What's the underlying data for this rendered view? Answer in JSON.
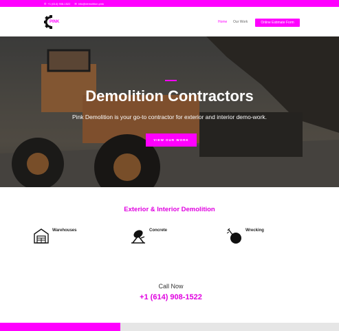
{
  "topbar": {
    "phone": "+1 (614) 908-1522",
    "email": "info@demolition.pink",
    "phone_icon": "phone-icon",
    "email_icon": "envelope-icon"
  },
  "header": {
    "logo_text": "PINK",
    "logo_icon": "gear-icon",
    "nav": [
      {
        "label": "Home",
        "active": true
      },
      {
        "label": "Our Work",
        "active": false
      }
    ],
    "cta_label": "Online Estimate Form"
  },
  "hero": {
    "title": "Demolition Contractors",
    "subtitle": "Pink Demolition is your go-to contractor for exterior and interior demo-work.",
    "button_label": "VIEW OUR WORK"
  },
  "services": {
    "title": "Exterior & Interior Demolition",
    "items": [
      {
        "label": "Warehouses",
        "icon": "warehouse-icon"
      },
      {
        "label": "Concrete",
        "icon": "concrete-mixer-icon"
      },
      {
        "label": "Wrecking",
        "icon": "wrecking-ball-icon"
      }
    ]
  },
  "call": {
    "label": "Call Now",
    "number": "+1 (614) 908-1522"
  },
  "progress": {
    "fraction": 0.355
  },
  "colors": {
    "accent": "#ff00ff",
    "accent_text": "#e000e0",
    "progress_track": "#e6e6e6"
  }
}
